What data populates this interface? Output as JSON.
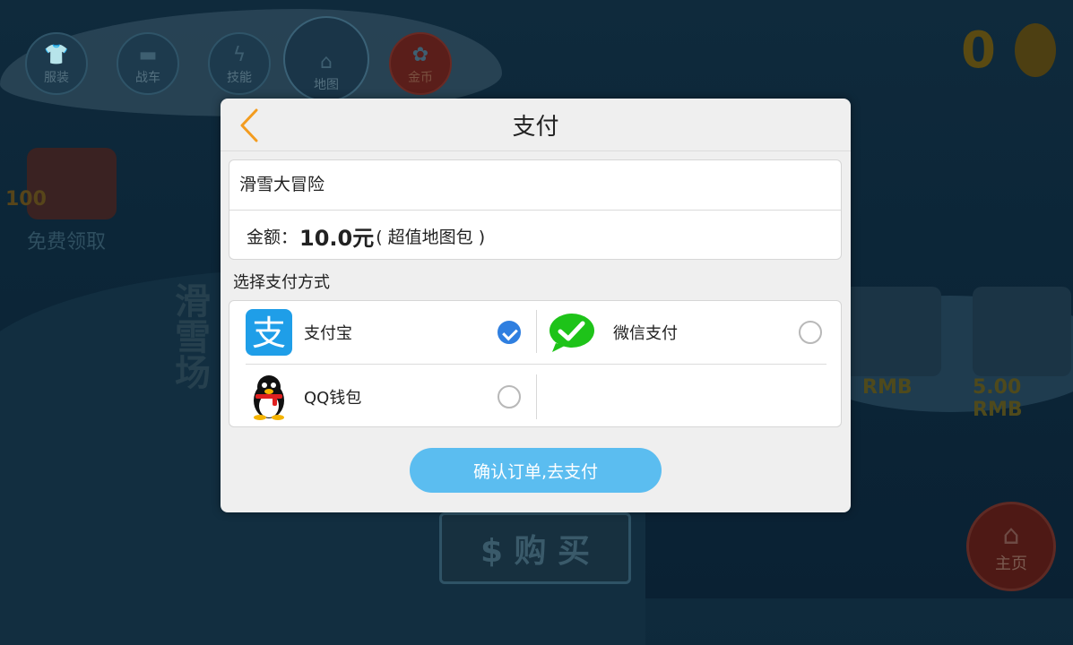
{
  "background": {
    "nav_buttons": [
      {
        "label": "服装",
        "icon": "shirt-icon"
      },
      {
        "label": "战车",
        "icon": "vehicle-icon"
      },
      {
        "label": "技能",
        "icon": "lightning-icon"
      },
      {
        "label": "地图",
        "icon": "house-icon"
      },
      {
        "label": "金币",
        "icon": "coin-icon"
      }
    ],
    "score": "0",
    "gift_count": "100",
    "gift_text": "免费领取",
    "vertical_title": "滑雪场",
    "prices": [
      "RMB",
      "5.00 RMB"
    ],
    "buy_label": "$ 购 买",
    "home_label": "主页"
  },
  "dialog": {
    "title": "支付",
    "product_name": "滑雪大冒险",
    "amount_prefix": "金额：",
    "amount_value": "10.0元",
    "amount_note": "( 超值地图包 )",
    "section_label": "选择支付方式",
    "methods": [
      {
        "label": "支付宝",
        "icon": "alipay-icon",
        "selected": true
      },
      {
        "label": "微信支付",
        "icon": "wechat-icon",
        "selected": false
      },
      {
        "label": "QQ钱包",
        "icon": "qq-penguin-icon",
        "selected": false
      }
    ],
    "confirm_label": "确认订单,去支付"
  },
  "colors": {
    "accent_blue": "#5bbdf0",
    "checked_blue": "#2f7fe0",
    "back_orange": "#f39c1f",
    "alipay_blue": "#1f9ee8",
    "wechat_green": "#1ec319"
  }
}
